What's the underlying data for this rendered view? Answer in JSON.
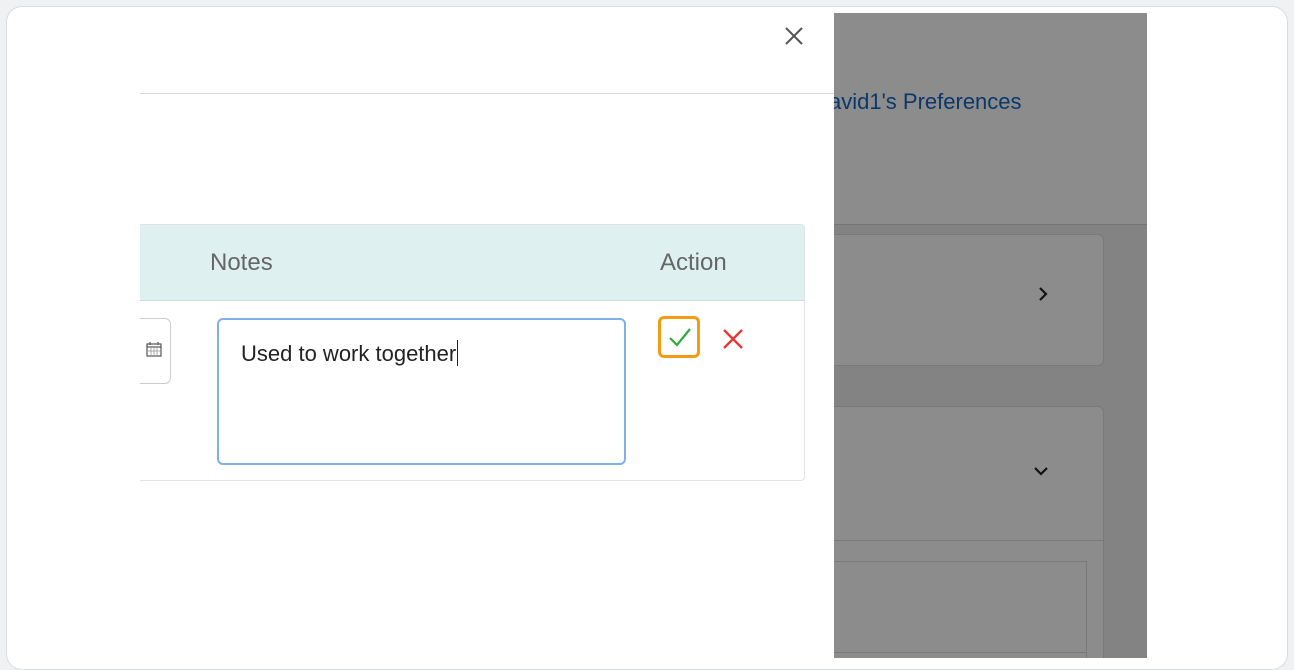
{
  "background": {
    "header_link": "avid1's Preferences",
    "card1_icon": "chevron-right-icon",
    "card2_icon": "chevron-down-icon"
  },
  "modal": {
    "close_icon": "close-icon",
    "table": {
      "headers": {
        "notes": "Notes",
        "action": "Action"
      },
      "row": {
        "date_icon": "calendar-icon",
        "notes_value": "Used to work together",
        "confirm_icon": "check-icon",
        "cancel_icon": "close-icon"
      }
    }
  },
  "colors": {
    "table_header_bg": "#dff0f0",
    "link": "#1565c0",
    "focus_border": "#7fb0e8",
    "highlight_border": "#f39c12",
    "check": "#2eaa3c",
    "cancel": "#e53935"
  }
}
